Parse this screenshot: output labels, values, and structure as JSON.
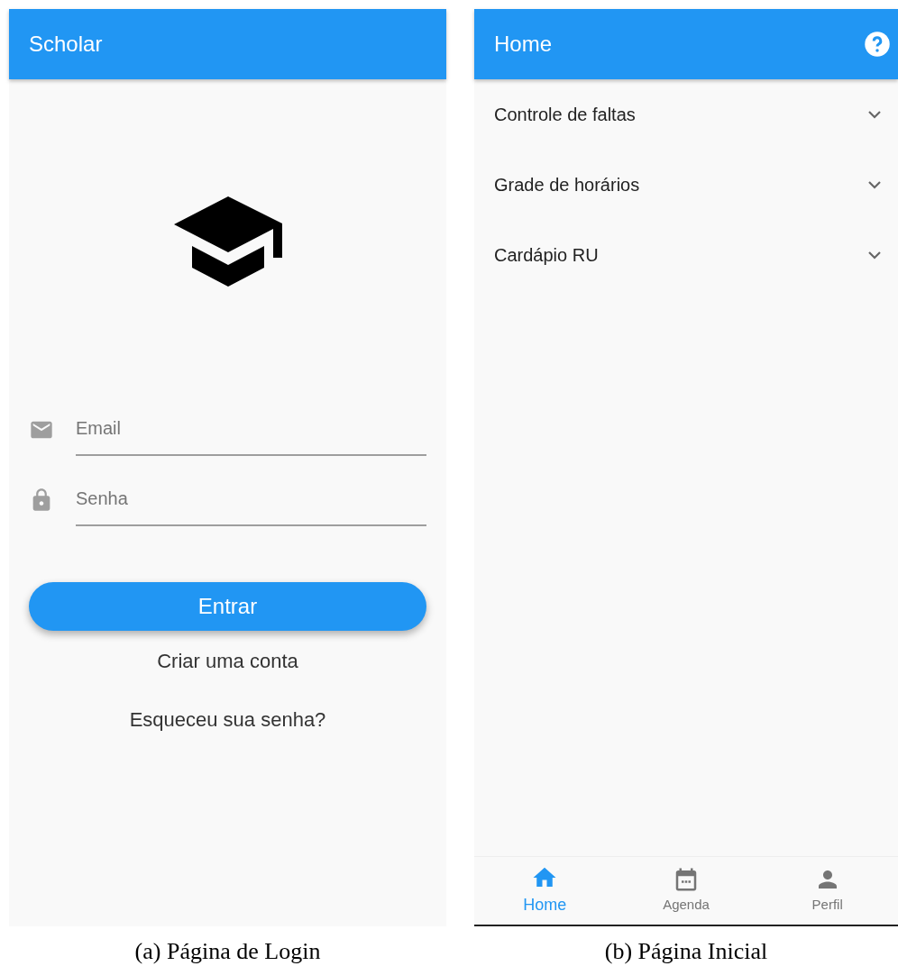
{
  "login_screen": {
    "app_bar": {
      "title": "Scholar"
    },
    "fields": [
      {
        "kind": "email",
        "placeholder": "Email"
      },
      {
        "kind": "password",
        "placeholder": "Senha"
      }
    ],
    "submit_button": "Entrar",
    "links": [
      "Criar uma conta",
      "Esqueceu sua senha?"
    ],
    "caption": "(a) Página de Login"
  },
  "home_screen": {
    "app_bar": {
      "title": "Home"
    },
    "sections": [
      {
        "label": "Controle de faltas",
        "expanded": false
      },
      {
        "label": "Grade de horários",
        "expanded": false
      },
      {
        "label": "Cardápio RU",
        "expanded": false
      }
    ],
    "bottom_nav": [
      {
        "kind": "home",
        "label": "Home",
        "selected": true
      },
      {
        "kind": "calendar",
        "label": "Agenda",
        "selected": false
      },
      {
        "kind": "person",
        "label": "Perfil",
        "selected": false
      }
    ],
    "caption": "(b) Página Inicial"
  }
}
